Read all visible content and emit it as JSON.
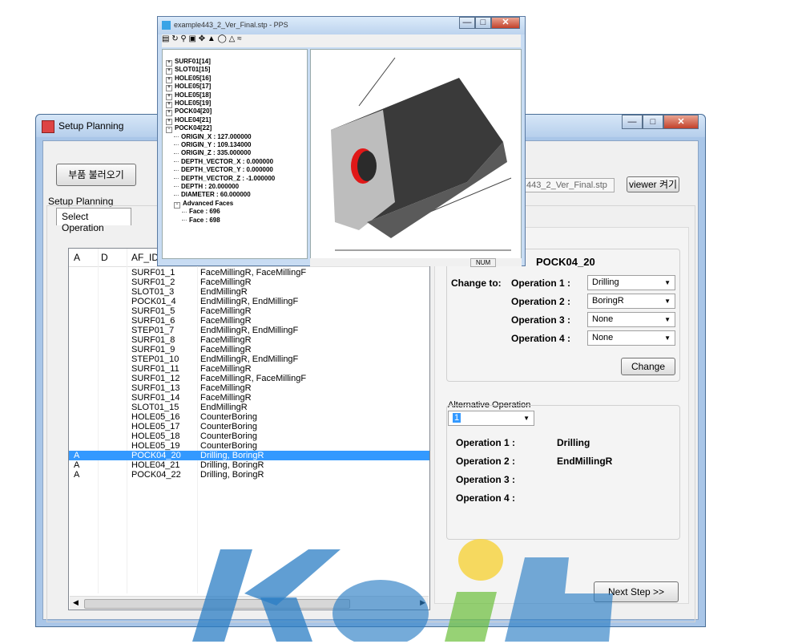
{
  "main_window": {
    "title": "Setup Planning"
  },
  "top_bar": {
    "load_button": "부품 불러오기",
    "file_name": "443_2_Ver_Final.stp",
    "viewer_button": "viewer 켜기"
  },
  "group_label": "Setup Planning",
  "tab": "Select Operation",
  "list": {
    "headers": [
      "A",
      "D",
      "AF_ID",
      ""
    ],
    "rows": [
      {
        "a": "",
        "d": "",
        "id": "SURF01_1",
        "ops": "FaceMillingR, FaceMillingF"
      },
      {
        "a": "",
        "d": "",
        "id": "SURF01_2",
        "ops": "FaceMillingR"
      },
      {
        "a": "",
        "d": "",
        "id": "SLOT01_3",
        "ops": "EndMillingR"
      },
      {
        "a": "",
        "d": "",
        "id": "POCK01_4",
        "ops": "EndMillingR, EndMillingF"
      },
      {
        "a": "",
        "d": "",
        "id": "SURF01_5",
        "ops": "FaceMillingR"
      },
      {
        "a": "",
        "d": "",
        "id": "SURF01_6",
        "ops": "FaceMillingR"
      },
      {
        "a": "",
        "d": "",
        "id": "STEP01_7",
        "ops": "EndMillingR, EndMillingF"
      },
      {
        "a": "",
        "d": "",
        "id": "SURF01_8",
        "ops": "FaceMillingR"
      },
      {
        "a": "",
        "d": "",
        "id": "SURF01_9",
        "ops": "FaceMillingR"
      },
      {
        "a": "",
        "d": "",
        "id": "STEP01_10",
        "ops": "EndMillingR, EndMillingF"
      },
      {
        "a": "",
        "d": "",
        "id": "SURF01_11",
        "ops": "FaceMillingR"
      },
      {
        "a": "",
        "d": "",
        "id": "SURF01_12",
        "ops": "FaceMillingR, FaceMillingF"
      },
      {
        "a": "",
        "d": "",
        "id": "SURF01_13",
        "ops": "FaceMillingR"
      },
      {
        "a": "",
        "d": "",
        "id": "SURF01_14",
        "ops": "FaceMillingR"
      },
      {
        "a": "",
        "d": "",
        "id": "SLOT01_15",
        "ops": "EndMillingR"
      },
      {
        "a": "",
        "d": "",
        "id": "HOLE05_16",
        "ops": "CounterBoring"
      },
      {
        "a": "",
        "d": "",
        "id": "HOLE05_17",
        "ops": "CounterBoring"
      },
      {
        "a": "",
        "d": "",
        "id": "HOLE05_18",
        "ops": "CounterBoring"
      },
      {
        "a": "",
        "d": "",
        "id": "HOLE05_19",
        "ops": "CounterBoring"
      },
      {
        "a": "A",
        "d": "",
        "id": "POCK04_20",
        "ops": "Drilling, BoringR",
        "selected": true
      },
      {
        "a": "A",
        "d": "",
        "id": "HOLE04_21",
        "ops": "Drilling, BoringR"
      },
      {
        "a": "A",
        "d": "",
        "id": "POCK04_22",
        "ops": "Drilling, BoringR"
      }
    ]
  },
  "change_panel": {
    "feature": "POCK04_20",
    "change_to": "Change to:",
    "operations": [
      {
        "label": "Operation 1 :",
        "value": "Drilling"
      },
      {
        "label": "Operation 2 :",
        "value": "BoringR"
      },
      {
        "label": "Operation 3 :",
        "value": "None"
      },
      {
        "label": "Operation 4 :",
        "value": "None"
      }
    ],
    "change_button": "Change"
  },
  "alt_panel": {
    "title": "Alternative Operation",
    "selected": "1",
    "operations": [
      {
        "label": "Operation 1 :",
        "value": "Drilling"
      },
      {
        "label": "Operation 2 :",
        "value": "EndMillingR"
      },
      {
        "label": "Operation 3 :",
        "value": ""
      },
      {
        "label": "Operation 4 :",
        "value": ""
      }
    ]
  },
  "next_button": "Next Step >>",
  "viewer": {
    "title": "example443_2_Ver_Final.stp - PPS",
    "status": "NUM",
    "tree": [
      {
        "t": "SURF01[14]",
        "indent": 0,
        "exp": "+"
      },
      {
        "t": "SLOT01[15]",
        "indent": 0,
        "exp": "+"
      },
      {
        "t": "HOLE05[16]",
        "indent": 0,
        "exp": "+"
      },
      {
        "t": "HOLE05[17]",
        "indent": 0,
        "exp": "+"
      },
      {
        "t": "HOLE05[18]",
        "indent": 0,
        "exp": "+"
      },
      {
        "t": "HOLE05[19]",
        "indent": 0,
        "exp": "+"
      },
      {
        "t": "POCK04[20]",
        "indent": 0,
        "exp": "+"
      },
      {
        "t": "HOLE04[21]",
        "indent": 0,
        "exp": "+"
      },
      {
        "t": "POCK04[22]",
        "indent": 0,
        "exp": "-"
      },
      {
        "t": "ORIGIN_X : 127.000000",
        "indent": 1,
        "exp": ""
      },
      {
        "t": "ORIGIN_Y : 109.134000",
        "indent": 1,
        "exp": ""
      },
      {
        "t": "ORIGIN_Z : 335.000000",
        "indent": 1,
        "exp": ""
      },
      {
        "t": "DEPTH_VECTOR_X : 0.000000",
        "indent": 1,
        "exp": ""
      },
      {
        "t": "DEPTH_VECTOR_Y : 0.000000",
        "indent": 1,
        "exp": ""
      },
      {
        "t": "DEPTH_VECTOR_Z : -1.000000",
        "indent": 1,
        "exp": ""
      },
      {
        "t": "DEPTH : 20.000000",
        "indent": 1,
        "exp": ""
      },
      {
        "t": "DIAMETER : 60.000000",
        "indent": 1,
        "exp": ""
      },
      {
        "t": "Advanced Faces",
        "indent": 1,
        "exp": "-"
      },
      {
        "t": "Face : 696",
        "indent": 2,
        "exp": ""
      },
      {
        "t": "Face : 698",
        "indent": 2,
        "exp": ""
      }
    ]
  },
  "watermark": {
    "text": "KEIT",
    "logo": "Keit"
  }
}
